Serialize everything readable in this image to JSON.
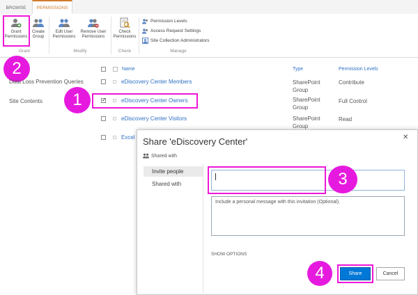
{
  "ribbon": {
    "tabs": [
      {
        "label": "BROWSE"
      },
      {
        "label": "PERMISSIONS"
      }
    ],
    "groups": {
      "grant": {
        "label": "Grant"
      },
      "modify": {
        "label": "Modify"
      },
      "check": {
        "label": "Check"
      },
      "manage": {
        "label": "Manage"
      }
    },
    "buttons": {
      "grant_permissions": {
        "line1": "Grant",
        "line2": "Permissions"
      },
      "create_group": {
        "line1": "Create",
        "line2": "Group"
      },
      "edit_user_permissions": {
        "line1": "Edit User",
        "line2": "Permissions"
      },
      "remove_user_permissions": {
        "line1": "Remove User",
        "line2": "Permissions"
      },
      "check_permissions": {
        "line1": "Check",
        "line2": "Permissions"
      }
    },
    "manage_items": [
      {
        "label": "Permission Levels"
      },
      {
        "label": "Access Request Settings"
      },
      {
        "label": "Site Collection Administrators"
      }
    ]
  },
  "left_nav": [
    {
      "label": "Data Loss Prevention Queries"
    },
    {
      "label": "Site Contents"
    }
  ],
  "table": {
    "headers": {
      "name": "Name",
      "type": "Type",
      "levels": "Permission Levels"
    },
    "rows": [
      {
        "name": "eDiscovery Center Members",
        "type": "SharePoint Group",
        "level": "Contribute",
        "checked": false
      },
      {
        "name": "eDiscovery Center Owners",
        "type": "SharePoint Group",
        "level": "Full Control",
        "checked": true
      },
      {
        "name": "eDiscovery Center Visitors",
        "type": "SharePoint Group",
        "level": "Read",
        "checked": false
      },
      {
        "name": "Excel",
        "type": "",
        "level": "",
        "checked": false
      }
    ]
  },
  "dialog": {
    "title": "Share 'eDiscovery Center'",
    "close_glyph": "✕",
    "shared_with_link": "Shared with",
    "side_items": [
      {
        "label": "Invite people"
      },
      {
        "label": "Shared with"
      }
    ],
    "invite_placeholder": "",
    "message_placeholder": "Include a personal message with this invitation (Optional).",
    "show_options": "SHOW OPTIONS",
    "share_button": "Share",
    "cancel_button": "Cancel"
  },
  "callouts": [
    {
      "number": "1"
    },
    {
      "number": "2"
    },
    {
      "number": "3"
    },
    {
      "number": "4"
    }
  ],
  "colors": {
    "highlight": "#ee17d6",
    "link": "#2e70c4",
    "primary": "#0078d7",
    "accent_tab": "#d07c2f"
  }
}
